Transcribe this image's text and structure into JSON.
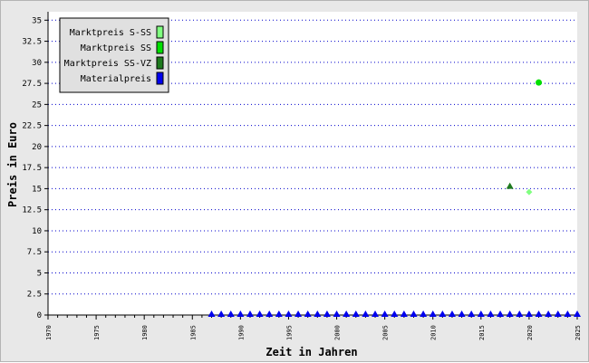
{
  "chart_data": {
    "type": "scatter",
    "xlabel": "Zeit in Jahren",
    "ylabel": "Preis in Euro",
    "xlim": [
      1970,
      2025
    ],
    "ylim": [
      0,
      36
    ],
    "x_major_ticks": [
      1970,
      1975,
      1980,
      1985,
      1990,
      1995,
      2000,
      2005,
      2010,
      2015,
      2020,
      2025
    ],
    "y_ticks": [
      0,
      2.5,
      5,
      7.5,
      10,
      12.5,
      15,
      17.5,
      20,
      22.5,
      25,
      27.5,
      30,
      32.5,
      35
    ],
    "y_tick_labels": [
      "0",
      "2.5",
      "5",
      "7.5",
      "10",
      "12.5",
      "15",
      "17.5",
      "20",
      "22.5",
      "25",
      "27.5",
      "30",
      "32.5",
      "35"
    ],
    "grid": "horizontal dotted blue",
    "legend_position": "top-left",
    "legend": [
      {
        "label": "Marktpreis S-SS",
        "color": "#80ff80"
      },
      {
        "label": "Marktpreis SS",
        "color": "#00e000"
      },
      {
        "label": "Marktpreis SS-VZ",
        "color": "#1e7a1e"
      },
      {
        "label": "Materialpreis",
        "color": "#0000ee"
      }
    ],
    "series": [
      {
        "name": "Marktpreis S-SS",
        "marker": "diamond",
        "color": "#80ff80",
        "points": [
          [
            2020,
            14.6
          ]
        ]
      },
      {
        "name": "Marktpreis SS",
        "marker": "circle",
        "color": "#00e000",
        "points": [
          [
            2021,
            27.6
          ]
        ]
      },
      {
        "name": "Marktpreis SS-VZ",
        "marker": "triangle",
        "color": "#1e7a1e",
        "points": [
          [
            2018,
            15.3
          ]
        ]
      },
      {
        "name": "Materialpreis",
        "marker": "triangle",
        "color": "#0000ee",
        "x_start": 1987,
        "x_end": 2025,
        "y": 0
      }
    ]
  }
}
